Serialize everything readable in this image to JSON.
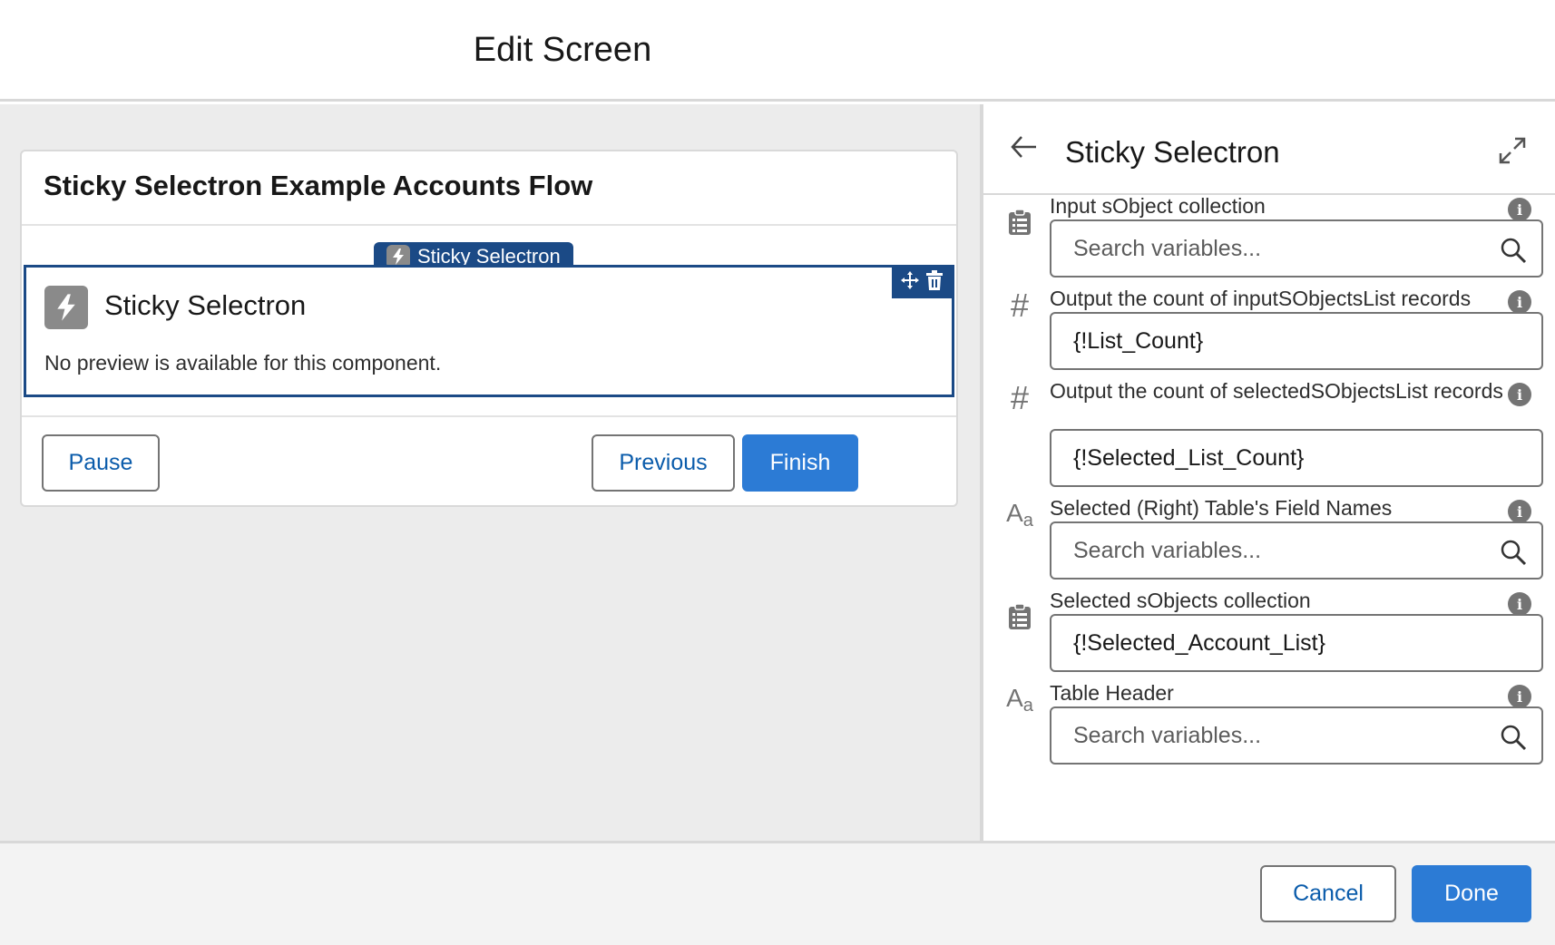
{
  "header": {
    "title": "Edit Screen"
  },
  "canvas": {
    "screen_title": "Sticky Selectron Example Accounts Flow",
    "component_tab_label": "Sticky Selectron",
    "component_name": "Sticky Selectron",
    "component_message": "No preview is available for this component.",
    "buttons": {
      "pause": "Pause",
      "previous": "Previous",
      "finish": "Finish"
    }
  },
  "panel": {
    "title": "Sticky Selectron",
    "fields": [
      {
        "type_icon": "collection-icon",
        "label": "Input sObject collection",
        "value": "",
        "placeholder": "Search variables..."
      },
      {
        "type_icon": "number-icon",
        "label": "Output the count of inputSObjectsList records",
        "value": "{!List_Count}",
        "placeholder": ""
      },
      {
        "type_icon": "number-icon",
        "label": "Output the count of selectedSObjectsList records",
        "value": "{!Selected_List_Count}",
        "placeholder": ""
      },
      {
        "type_icon": "text-icon",
        "label": "Selected (Right) Table's Field Names",
        "value": "",
        "placeholder": "Search variables..."
      },
      {
        "type_icon": "collection-icon",
        "label": "Selected sObjects collection",
        "value": "{!Selected_Account_List}",
        "placeholder": ""
      },
      {
        "type_icon": "text-icon",
        "label": "Table Header",
        "value": "",
        "placeholder": "Search variables..."
      }
    ]
  },
  "footer": {
    "cancel": "Cancel",
    "done": "Done"
  },
  "colors": {
    "brand": "#2c7bd5",
    "component_highlight": "#1b4a86",
    "link": "#0b5cab"
  }
}
